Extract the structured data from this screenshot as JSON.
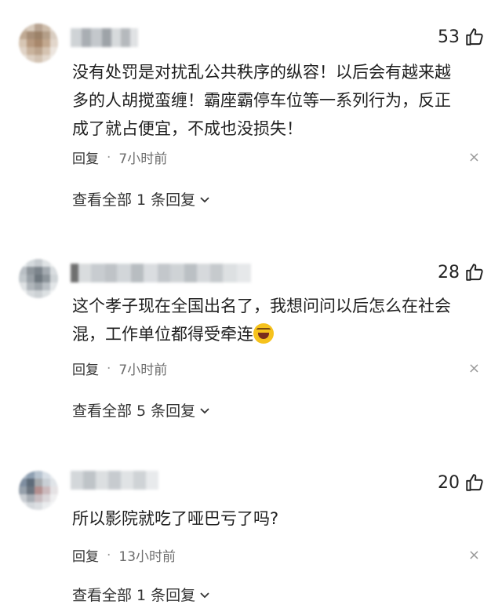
{
  "comments": [
    {
      "likes": "53",
      "text_lines": [
        "没有处罚是对扰乱公共秩序的纵容！以后会有越来越",
        "多的人胡搅蛮缠！霸座霸停车位等一系列行为，反正",
        "成了就占便宜，不成也没损失！"
      ],
      "reply_label": "回复",
      "separator": "·",
      "time": "7小时前",
      "close": "×",
      "view_replies": "查看全部 1 条回复"
    },
    {
      "likes": "28",
      "text_lines": [
        "这个孝子现在全国出名了，我想问问以后怎么在社会",
        "混，工作单位都得受牵连"
      ],
      "reply_label": "回复",
      "separator": "·",
      "time": "7小时前",
      "close": "×",
      "view_replies": "查看全部 5 条回复"
    },
    {
      "likes": "20",
      "text_lines": [
        "所以影院就吃了哑巴亏了吗?"
      ],
      "reply_label": "回复",
      "separator": "·",
      "time": "13小时前",
      "close": "×",
      "view_replies": "查看全部 1 条回复"
    }
  ],
  "icons": {
    "like": "thumbs-up-icon",
    "expand": "chevron-down-icon",
    "emoji": "laughing-crying-emoji-icon",
    "close": "close-icon"
  },
  "colors": {
    "text": "#1f1f1f",
    "meta": "#6d6d6d",
    "close": "#9a9a9a"
  }
}
